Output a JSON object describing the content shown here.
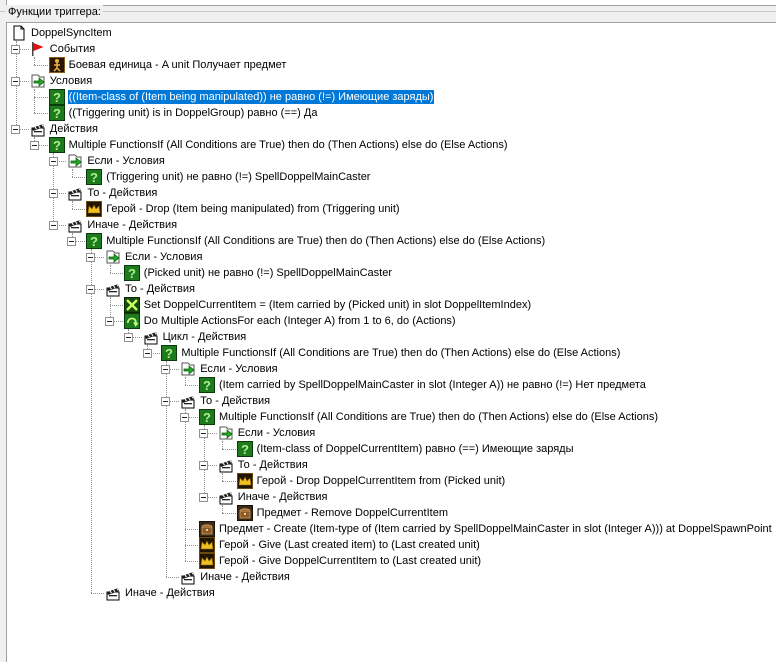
{
  "panel": {
    "title": "Функции триггера:"
  },
  "tree": [
    {
      "label": "DoppelSyncItem",
      "icon": "doc-icon",
      "level": 0,
      "exp": false
    },
    {
      "label": "События",
      "icon": "flag-icon",
      "level": 1,
      "exp": true
    },
    {
      "label": "Боевая единица - A unit Получает предмет",
      "icon": "event-icon",
      "level": 2,
      "exp": false
    },
    {
      "label": "Условия",
      "icon": "condition-folder-icon",
      "level": 1,
      "exp": true
    },
    {
      "label": "((Item-class of (Item being manipulated)) не равно (!=) Имеющие заряды)",
      "icon": "question-icon",
      "level": 2,
      "exp": false,
      "selected": true
    },
    {
      "label": "((Triggering unit) is in DoppelGroup) равно (==) Да",
      "icon": "question-icon",
      "level": 2,
      "exp": false
    },
    {
      "label": "Действия",
      "icon": "clapper-icon",
      "level": 1,
      "exp": true
    },
    {
      "label": "Multiple FunctionsIf (All Conditions are True) then do (Then Actions) else do (Else Actions)",
      "icon": "question-icon",
      "level": 2,
      "exp": true
    },
    {
      "label": "Если - Условия",
      "icon": "condition-folder-icon",
      "level": 3,
      "exp": true
    },
    {
      "label": "(Triggering unit) не равно (!=) SpellDoppelMainCaster",
      "icon": "question-icon",
      "level": 4,
      "exp": false
    },
    {
      "label": "То - Действия",
      "icon": "clapper-icon",
      "level": 3,
      "exp": true
    },
    {
      "label": "Герой - Drop (Item being manipulated) from (Triggering unit)",
      "icon": "crown-icon",
      "level": 4,
      "exp": false
    },
    {
      "label": "Иначе - Действия",
      "icon": "clapper-icon",
      "level": 3,
      "exp": true
    },
    {
      "label": "Multiple FunctionsIf (All Conditions are True) then do (Then Actions) else do (Else Actions)",
      "icon": "question-icon",
      "level": 4,
      "exp": true
    },
    {
      "label": "Если - Условия",
      "icon": "condition-folder-icon",
      "level": 5,
      "exp": true
    },
    {
      "label": "(Picked unit) не равно (!=) SpellDoppelMainCaster",
      "icon": "question-icon",
      "level": 6,
      "exp": false
    },
    {
      "label": "То - Действия",
      "icon": "clapper-icon",
      "level": 5,
      "exp": true
    },
    {
      "label": "Set DoppelCurrentItem = (Item carried by (Picked unit) in slot DoppelItemIndex)",
      "icon": "set-icon",
      "level": 6,
      "exp": false
    },
    {
      "label": "Do Multiple ActionsFor each (Integer A) from 1 to 6, do (Actions)",
      "icon": "loop-icon",
      "level": 6,
      "exp": true
    },
    {
      "label": "Цикл - Действия",
      "icon": "clapper-icon",
      "level": 7,
      "exp": true
    },
    {
      "label": "Multiple FunctionsIf (All Conditions are True) then do (Then Actions) else do (Else Actions)",
      "icon": "question-icon",
      "level": 8,
      "exp": true
    },
    {
      "label": "Если - Условия",
      "icon": "condition-folder-icon",
      "level": 9,
      "exp": true
    },
    {
      "label": "(Item carried by SpellDoppelMainCaster in slot (Integer A)) не равно (!=) Нет предмета",
      "icon": "question-icon",
      "level": 10,
      "exp": false
    },
    {
      "label": "То - Действия",
      "icon": "clapper-icon",
      "level": 9,
      "exp": true
    },
    {
      "label": "Multiple FunctionsIf (All Conditions are True) then do (Then Actions) else do (Else Actions)",
      "icon": "question-icon",
      "level": 10,
      "exp": true
    },
    {
      "label": "Если - Условия",
      "icon": "condition-folder-icon",
      "level": 11,
      "exp": true
    },
    {
      "label": "(Item-class of DoppelCurrentItem) равно (==) Имеющие заряды",
      "icon": "question-icon",
      "level": 12,
      "exp": false
    },
    {
      "label": "То - Действия",
      "icon": "clapper-icon",
      "level": 11,
      "exp": true
    },
    {
      "label": "Герой - Drop DoppelCurrentItem from (Picked unit)",
      "icon": "crown-icon",
      "level": 12,
      "exp": false
    },
    {
      "label": "Иначе - Действия",
      "icon": "clapper-icon",
      "level": 11,
      "exp": true
    },
    {
      "label": "Предмет - Remove DoppelCurrentItem",
      "icon": "chest-icon",
      "level": 12,
      "exp": false
    },
    {
      "label": "Предмет - Create (Item-type of (Item carried by SpellDoppelMainCaster in slot (Integer A))) at DoppelSpawnPoint",
      "icon": "chest-icon",
      "level": 10,
      "exp": false
    },
    {
      "label": "Герой - Give (Last created item) to (Last created unit)",
      "icon": "crown-icon",
      "level": 10,
      "exp": false
    },
    {
      "label": "Герой - Give DoppelCurrentItem to (Last created unit)",
      "icon": "crown-icon",
      "level": 10,
      "exp": false
    },
    {
      "label": "Иначе - Действия",
      "icon": "clapper-icon",
      "level": 9,
      "exp": false
    },
    {
      "label": "Иначе - Действия",
      "icon": "clapper-icon",
      "level": 5,
      "exp": false
    }
  ]
}
